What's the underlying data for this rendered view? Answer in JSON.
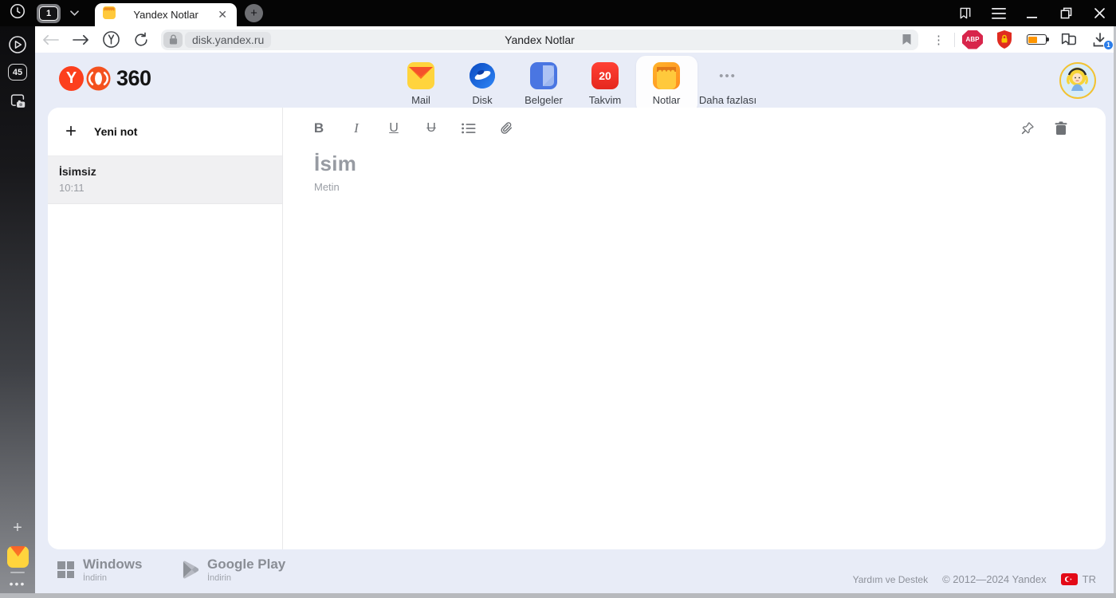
{
  "titlebar": {
    "tab_group_count": "1",
    "tab_title": "Yandex Notlar"
  },
  "toolbar": {
    "url": "disk.yandex.ru",
    "page_title": "Yandex Notlar",
    "adblock_label": "ABP",
    "download_badge": "1"
  },
  "browser_sidebar": {
    "badge_count": "45"
  },
  "header": {
    "logo_suffix": "360",
    "services": [
      {
        "label": "Mail",
        "icon": "mail-icon"
      },
      {
        "label": "Disk",
        "icon": "disk-icon"
      },
      {
        "label": "Belgeler",
        "icon": "documents-icon"
      },
      {
        "label": "Takvim",
        "icon": "calendar-icon",
        "badge": "20"
      },
      {
        "label": "Notlar",
        "icon": "notes-icon",
        "active": true
      },
      {
        "label": "Daha fazlası",
        "icon": "more-dots-icon"
      }
    ]
  },
  "notes_panel": {
    "new_note_label": "Yeni not",
    "items": [
      {
        "title": "İsimsiz",
        "time": "10:11"
      }
    ]
  },
  "editor": {
    "title_placeholder": "İsim",
    "body_placeholder": "Metin"
  },
  "footer": {
    "downloads": [
      {
        "platform": "Windows",
        "action": "İndirin"
      },
      {
        "platform": "Google Play",
        "action": "İndirin"
      }
    ],
    "help_link": "Yardım ve Destek",
    "copyright": "© 2012—2024 Yandex",
    "locale": "TR"
  },
  "colors": {
    "page_background": "#e8ecf7",
    "accent_red": "#fc3f1d",
    "note_yellow": "#ffce3d",
    "battery_orange": "#ff9500",
    "download_badge_blue": "#2b7de9"
  }
}
